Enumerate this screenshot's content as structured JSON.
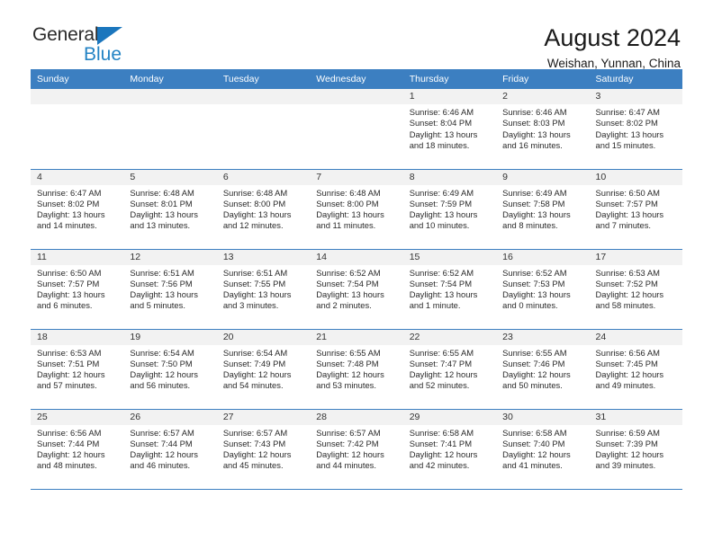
{
  "brand": {
    "name_top": "General",
    "name_bottom": "Blue",
    "triangle_color": "#1b76bd",
    "blue_text_color": "#2383c4"
  },
  "header": {
    "title": "August 2024",
    "subtitle": "Weishan, Yunnan, China"
  },
  "theme": {
    "header_blue": "#3c7fc1",
    "daynum_bg": "#f2f2f2",
    "text": "#2a2a2a"
  },
  "weekdays": [
    "Sunday",
    "Monday",
    "Tuesday",
    "Wednesday",
    "Thursday",
    "Friday",
    "Saturday"
  ],
  "labels": {
    "sunrise_prefix": "Sunrise:",
    "sunset_prefix": "Sunset:",
    "daylight_prefix": "Daylight:"
  },
  "weeks": [
    [
      {
        "day": "",
        "empty": true
      },
      {
        "day": "",
        "empty": true
      },
      {
        "day": "",
        "empty": true
      },
      {
        "day": "",
        "empty": true
      },
      {
        "day": "1",
        "sunrise": "Sunrise: 6:46 AM",
        "sunset": "Sunset: 8:04 PM",
        "daylight_l1": "Daylight: 13 hours",
        "daylight_l2": "and 18 minutes."
      },
      {
        "day": "2",
        "sunrise": "Sunrise: 6:46 AM",
        "sunset": "Sunset: 8:03 PM",
        "daylight_l1": "Daylight: 13 hours",
        "daylight_l2": "and 16 minutes."
      },
      {
        "day": "3",
        "sunrise": "Sunrise: 6:47 AM",
        "sunset": "Sunset: 8:02 PM",
        "daylight_l1": "Daylight: 13 hours",
        "daylight_l2": "and 15 minutes."
      }
    ],
    [
      {
        "day": "4",
        "sunrise": "Sunrise: 6:47 AM",
        "sunset": "Sunset: 8:02 PM",
        "daylight_l1": "Daylight: 13 hours",
        "daylight_l2": "and 14 minutes."
      },
      {
        "day": "5",
        "sunrise": "Sunrise: 6:48 AM",
        "sunset": "Sunset: 8:01 PM",
        "daylight_l1": "Daylight: 13 hours",
        "daylight_l2": "and 13 minutes."
      },
      {
        "day": "6",
        "sunrise": "Sunrise: 6:48 AM",
        "sunset": "Sunset: 8:00 PM",
        "daylight_l1": "Daylight: 13 hours",
        "daylight_l2": "and 12 minutes."
      },
      {
        "day": "7",
        "sunrise": "Sunrise: 6:48 AM",
        "sunset": "Sunset: 8:00 PM",
        "daylight_l1": "Daylight: 13 hours",
        "daylight_l2": "and 11 minutes."
      },
      {
        "day": "8",
        "sunrise": "Sunrise: 6:49 AM",
        "sunset": "Sunset: 7:59 PM",
        "daylight_l1": "Daylight: 13 hours",
        "daylight_l2": "and 10 minutes."
      },
      {
        "day": "9",
        "sunrise": "Sunrise: 6:49 AM",
        "sunset": "Sunset: 7:58 PM",
        "daylight_l1": "Daylight: 13 hours",
        "daylight_l2": "and 8 minutes."
      },
      {
        "day": "10",
        "sunrise": "Sunrise: 6:50 AM",
        "sunset": "Sunset: 7:57 PM",
        "daylight_l1": "Daylight: 13 hours",
        "daylight_l2": "and 7 minutes."
      }
    ],
    [
      {
        "day": "11",
        "sunrise": "Sunrise: 6:50 AM",
        "sunset": "Sunset: 7:57 PM",
        "daylight_l1": "Daylight: 13 hours",
        "daylight_l2": "and 6 minutes."
      },
      {
        "day": "12",
        "sunrise": "Sunrise: 6:51 AM",
        "sunset": "Sunset: 7:56 PM",
        "daylight_l1": "Daylight: 13 hours",
        "daylight_l2": "and 5 minutes."
      },
      {
        "day": "13",
        "sunrise": "Sunrise: 6:51 AM",
        "sunset": "Sunset: 7:55 PM",
        "daylight_l1": "Daylight: 13 hours",
        "daylight_l2": "and 3 minutes."
      },
      {
        "day": "14",
        "sunrise": "Sunrise: 6:52 AM",
        "sunset": "Sunset: 7:54 PM",
        "daylight_l1": "Daylight: 13 hours",
        "daylight_l2": "and 2 minutes."
      },
      {
        "day": "15",
        "sunrise": "Sunrise: 6:52 AM",
        "sunset": "Sunset: 7:54 PM",
        "daylight_l1": "Daylight: 13 hours",
        "daylight_l2": "and 1 minute."
      },
      {
        "day": "16",
        "sunrise": "Sunrise: 6:52 AM",
        "sunset": "Sunset: 7:53 PM",
        "daylight_l1": "Daylight: 13 hours",
        "daylight_l2": "and 0 minutes."
      },
      {
        "day": "17",
        "sunrise": "Sunrise: 6:53 AM",
        "sunset": "Sunset: 7:52 PM",
        "daylight_l1": "Daylight: 12 hours",
        "daylight_l2": "and 58 minutes."
      }
    ],
    [
      {
        "day": "18",
        "sunrise": "Sunrise: 6:53 AM",
        "sunset": "Sunset: 7:51 PM",
        "daylight_l1": "Daylight: 12 hours",
        "daylight_l2": "and 57 minutes."
      },
      {
        "day": "19",
        "sunrise": "Sunrise: 6:54 AM",
        "sunset": "Sunset: 7:50 PM",
        "daylight_l1": "Daylight: 12 hours",
        "daylight_l2": "and 56 minutes."
      },
      {
        "day": "20",
        "sunrise": "Sunrise: 6:54 AM",
        "sunset": "Sunset: 7:49 PM",
        "daylight_l1": "Daylight: 12 hours",
        "daylight_l2": "and 54 minutes."
      },
      {
        "day": "21",
        "sunrise": "Sunrise: 6:55 AM",
        "sunset": "Sunset: 7:48 PM",
        "daylight_l1": "Daylight: 12 hours",
        "daylight_l2": "and 53 minutes."
      },
      {
        "day": "22",
        "sunrise": "Sunrise: 6:55 AM",
        "sunset": "Sunset: 7:47 PM",
        "daylight_l1": "Daylight: 12 hours",
        "daylight_l2": "and 52 minutes."
      },
      {
        "day": "23",
        "sunrise": "Sunrise: 6:55 AM",
        "sunset": "Sunset: 7:46 PM",
        "daylight_l1": "Daylight: 12 hours",
        "daylight_l2": "and 50 minutes."
      },
      {
        "day": "24",
        "sunrise": "Sunrise: 6:56 AM",
        "sunset": "Sunset: 7:45 PM",
        "daylight_l1": "Daylight: 12 hours",
        "daylight_l2": "and 49 minutes."
      }
    ],
    [
      {
        "day": "25",
        "sunrise": "Sunrise: 6:56 AM",
        "sunset": "Sunset: 7:44 PM",
        "daylight_l1": "Daylight: 12 hours",
        "daylight_l2": "and 48 minutes."
      },
      {
        "day": "26",
        "sunrise": "Sunrise: 6:57 AM",
        "sunset": "Sunset: 7:44 PM",
        "daylight_l1": "Daylight: 12 hours",
        "daylight_l2": "and 46 minutes."
      },
      {
        "day": "27",
        "sunrise": "Sunrise: 6:57 AM",
        "sunset": "Sunset: 7:43 PM",
        "daylight_l1": "Daylight: 12 hours",
        "daylight_l2": "and 45 minutes."
      },
      {
        "day": "28",
        "sunrise": "Sunrise: 6:57 AM",
        "sunset": "Sunset: 7:42 PM",
        "daylight_l1": "Daylight: 12 hours",
        "daylight_l2": "and 44 minutes."
      },
      {
        "day": "29",
        "sunrise": "Sunrise: 6:58 AM",
        "sunset": "Sunset: 7:41 PM",
        "daylight_l1": "Daylight: 12 hours",
        "daylight_l2": "and 42 minutes."
      },
      {
        "day": "30",
        "sunrise": "Sunrise: 6:58 AM",
        "sunset": "Sunset: 7:40 PM",
        "daylight_l1": "Daylight: 12 hours",
        "daylight_l2": "and 41 minutes."
      },
      {
        "day": "31",
        "sunrise": "Sunrise: 6:59 AM",
        "sunset": "Sunset: 7:39 PM",
        "daylight_l1": "Daylight: 12 hours",
        "daylight_l2": "and 39 minutes."
      }
    ]
  ]
}
